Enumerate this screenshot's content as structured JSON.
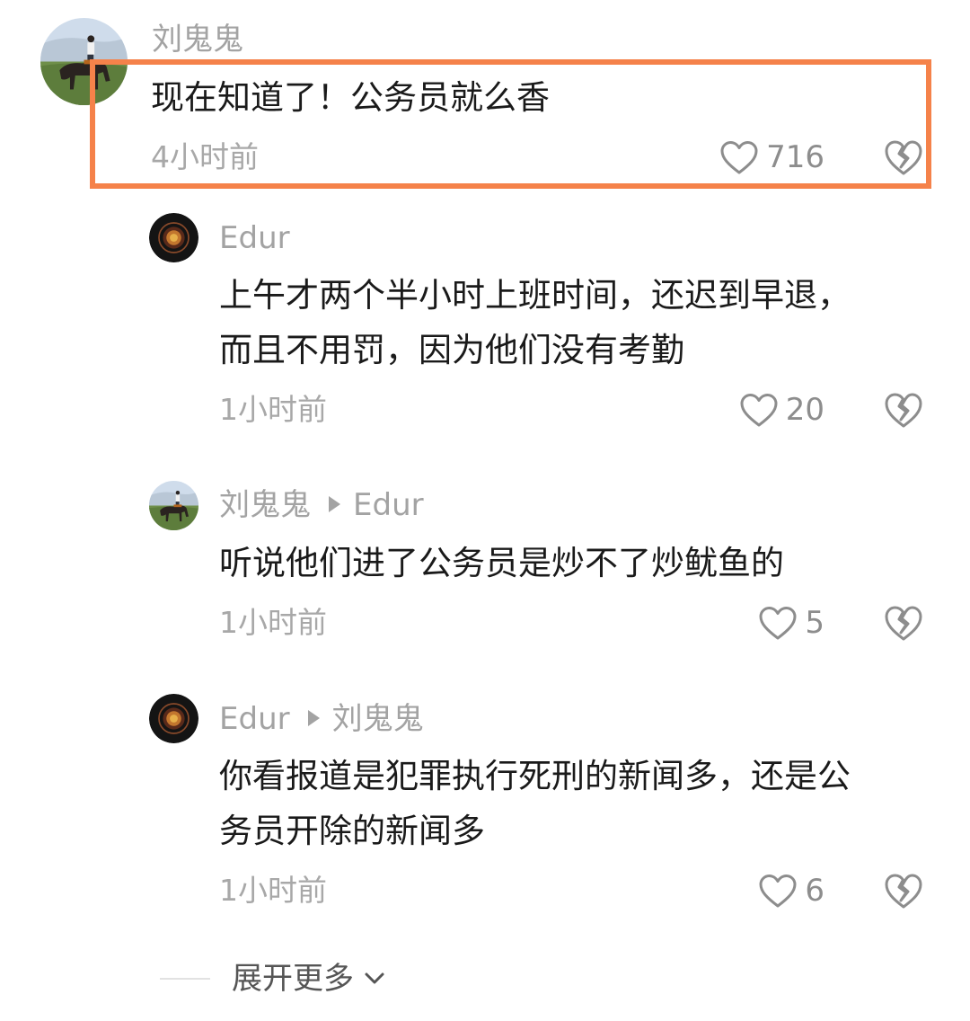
{
  "colors": {
    "highlight": "#f5824a",
    "username": "#a3a3a3",
    "text": "#1a1a1a",
    "meta": "#a8a8a8"
  },
  "comments": [
    {
      "user": "刘鬼鬼",
      "reply_to": "",
      "lines": [
        "现在知道了！公务员就么香"
      ],
      "time": "4小时前",
      "likes": "716",
      "avatar": "horse-rider-avatar"
    },
    {
      "user": "Edur",
      "reply_to": "",
      "lines": [
        "上午才两个半小时上班时间，还迟到早退，",
        "而且不用罚，因为他们没有考勤"
      ],
      "time": "1小时前",
      "likes": "20",
      "avatar": "dark-circle-avatar"
    },
    {
      "user": "刘鬼鬼",
      "reply_to": "Edur",
      "lines": [
        "听说他们进了公务员是炒不了炒鱿鱼的"
      ],
      "time": "1小时前",
      "likes": "5",
      "avatar": "horse-rider-avatar"
    },
    {
      "user": "Edur",
      "reply_to": "刘鬼鬼",
      "lines": [
        "你看报道是犯罪执行死刑的新闻多，还是公",
        "务员开除的新闻多"
      ],
      "time": "1小时前",
      "likes": "6",
      "avatar": "dark-circle-avatar"
    }
  ],
  "more_label": "展开更多",
  "icons": {
    "like": "heart-outline-icon",
    "dislike": "broken-heart-icon",
    "expand": "chevron-down-icon"
  }
}
